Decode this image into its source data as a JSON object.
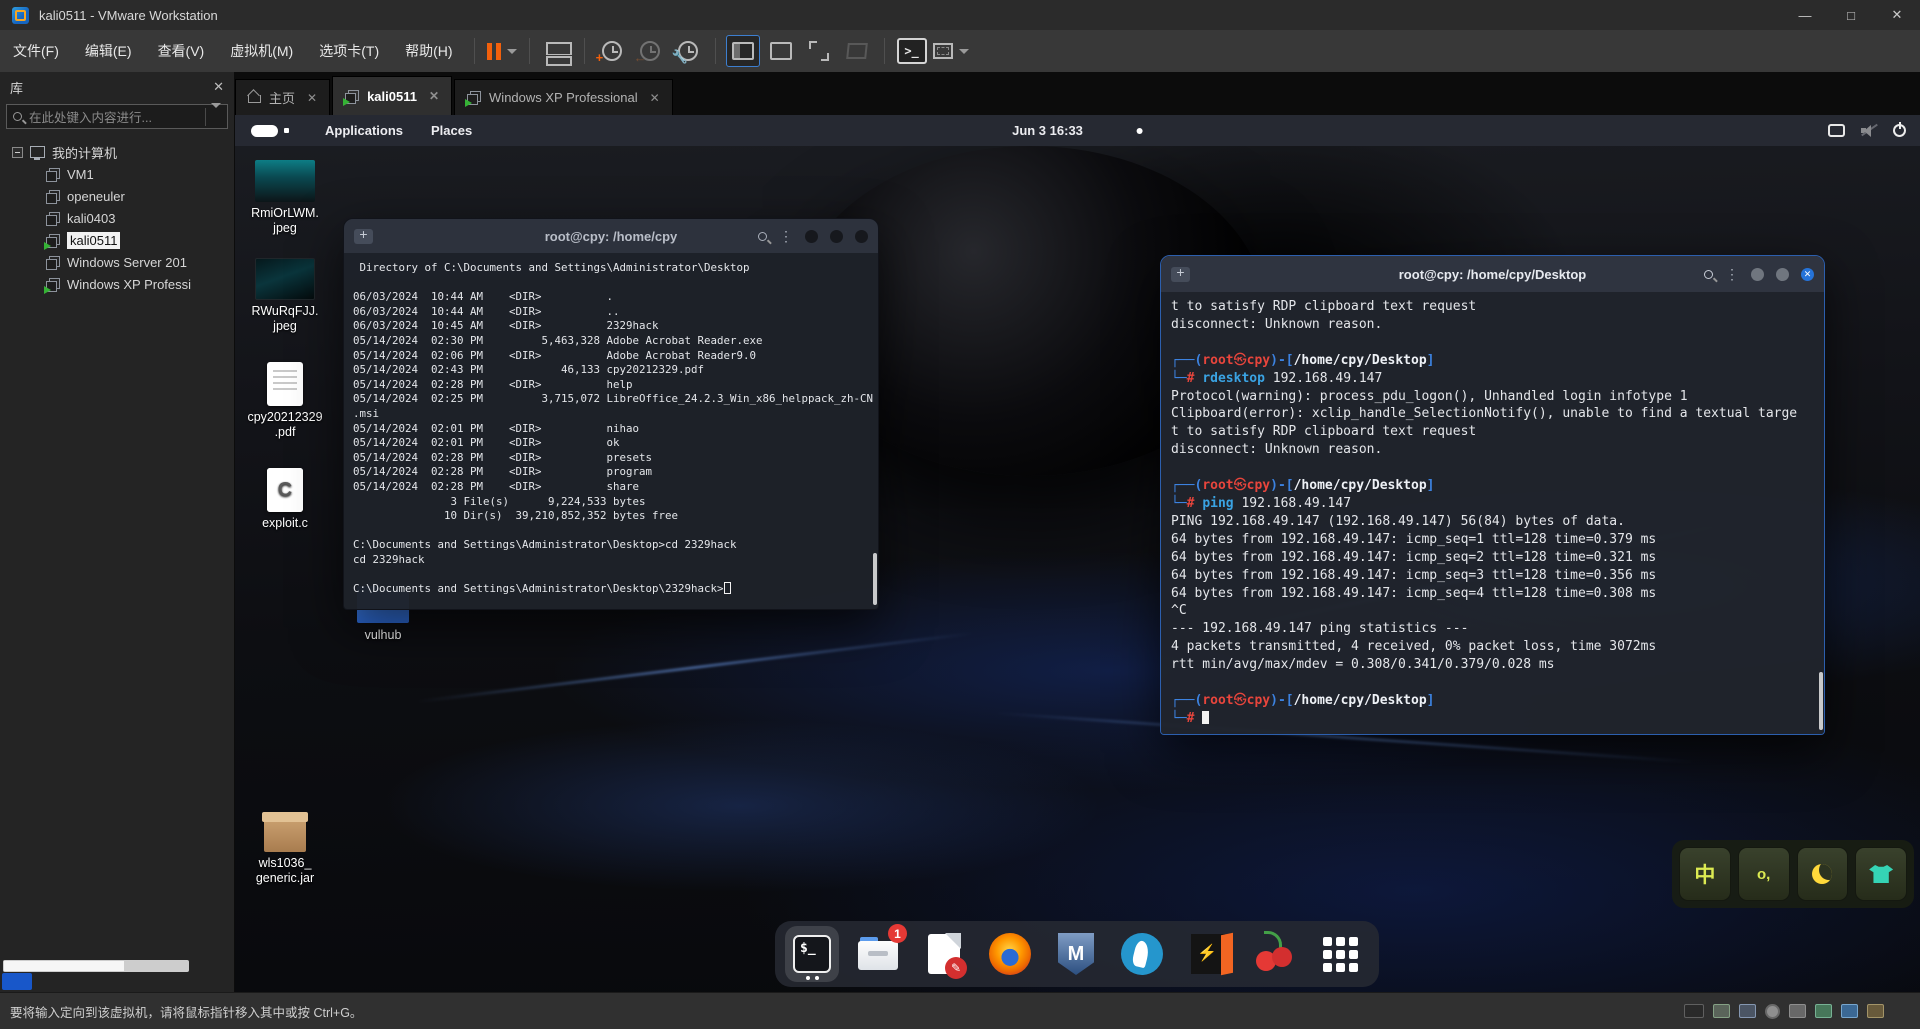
{
  "vmware": {
    "title": "kali0511 - VMware Workstation",
    "menus": [
      "文件(F)",
      "编辑(E)",
      "查看(V)",
      "虚拟机(M)",
      "选项卡(T)",
      "帮助(H)"
    ],
    "window_controls": {
      "minimize": "—",
      "maximize": "□",
      "close": "✕"
    },
    "tabs": [
      {
        "label": "主页",
        "close": "✕"
      },
      {
        "label": "kali0511",
        "close": "✕"
      },
      {
        "label": "Windows XP Professional",
        "close": "✕"
      }
    ],
    "sidebar": {
      "title": "库",
      "close": "✕",
      "search_placeholder": "在此处键入内容进行...",
      "root": "我的计算机",
      "vms": [
        {
          "name": "VM1"
        },
        {
          "name": "openeuler"
        },
        {
          "name": "kali0403"
        },
        {
          "name": "kali0511",
          "selected": true,
          "running": true
        },
        {
          "name": "Windows Server 201"
        },
        {
          "name": "Windows XP Professi",
          "running": true
        }
      ]
    },
    "statusbar": {
      "hint": "要将输入定向到该虚拟机，请将鼠标指针移入其中或按 Ctrl+G。",
      "device_icons": [
        "harddisk-icon",
        "harddisk2-icon",
        "cdrom-icon",
        "floppy-icon",
        "usb-icon",
        "network-icon",
        "sound-icon",
        "keyboard-icon"
      ]
    }
  },
  "kali": {
    "topbar": {
      "menu_applications": "Applications",
      "menu_places": "Places",
      "clock": "Jun 3 16:33",
      "tray_icons": [
        "display-icon",
        "audio-muted-icon",
        "power-icon"
      ]
    },
    "desktop_icons": [
      {
        "label1": "RmiOrLWM.",
        "label2": "jpeg",
        "type": "image"
      },
      {
        "label1": "RWuRqFJJ.",
        "label2": "jpeg",
        "type": "image"
      },
      {
        "label1": "cpy20212329",
        "label2": ".pdf",
        "type": "pdf"
      },
      {
        "label1": "exploit.c",
        "label2": "",
        "type": "code"
      },
      {
        "label1": "vulhub",
        "label2": "",
        "type": "folder"
      },
      {
        "label1": "wls1036_",
        "label2": "generic.jar",
        "type": "archive"
      }
    ],
    "dock": {
      "badge_count": "1",
      "items": [
        "terminal",
        "file-manager",
        "text-editor",
        "firefox",
        "metasploit",
        "wireshark",
        "burpsuite",
        "cherrytree",
        "app-grid"
      ]
    },
    "ime": {
      "chinese_mode": "中",
      "buttons": [
        "chinese-mode",
        "fullwidth-mode",
        "night-mode",
        "skin-picker"
      ]
    }
  },
  "term_left": {
    "title": "root@cpy: /home/cpy",
    "lines": [
      " Directory of C:\\Documents and Settings\\Administrator\\Desktop",
      "",
      "06/03/2024  10:44 AM    <DIR>          .",
      "06/03/2024  10:44 AM    <DIR>          ..",
      "06/03/2024  10:45 AM    <DIR>          2329hack",
      "05/14/2024  02:30 PM         5,463,328 Adobe Acrobat Reader.exe",
      "05/14/2024  02:06 PM    <DIR>          Adobe Acrobat Reader9.0",
      "05/14/2024  02:43 PM            46,133 cpy20212329.pdf",
      "05/14/2024  02:28 PM    <DIR>          help",
      "05/14/2024  02:25 PM         3,715,072 LibreOffice_24.2.3_Win_x86_helppack_zh-CN",
      ".msi",
      "05/14/2024  02:01 PM    <DIR>          nihao",
      "05/14/2024  02:01 PM    <DIR>          ok",
      "05/14/2024  02:28 PM    <DIR>          presets",
      "05/14/2024  02:28 PM    <DIR>          program",
      "05/14/2024  02:28 PM    <DIR>          share",
      "               3 File(s)      9,224,533 bytes",
      "              10 Dir(s)  39,210,852,352 bytes free",
      "",
      "C:\\Documents and Settings\\Administrator\\Desktop>cd 2329hack",
      "cd 2329hack",
      "",
      {
        "s": [
          [
            "C:\\Documents and Settings\\Administrator\\Desktop\\2329hack>",
            "p"
          ],
          [
            "",
            "curh"
          ]
        ]
      }
    ]
  },
  "term_right": {
    "title": "root@cpy: /home/cpy/Desktop",
    "lines": [
      "t to satisfy RDP clipboard text request",
      "disconnect: Unknown reason.",
      "",
      {
        "s": [
          [
            "┌──(",
            "b"
          ],
          [
            "root",
            "r"
          ],
          [
            "㉿",
            "rs"
          ],
          [
            "cpy",
            "r"
          ],
          [
            ")-[",
            "b"
          ],
          [
            "/home/cpy/Desktop",
            "w"
          ],
          [
            "]",
            "b"
          ]
        ]
      },
      {
        "s": [
          [
            "└─",
            "b"
          ],
          [
            "#",
            "r"
          ],
          [
            " ",
            "p"
          ],
          [
            "rdesktop",
            "c"
          ],
          [
            " 192.168.49.147",
            "p"
          ]
        ]
      },
      "Protocol(warning): process_pdu_logon(), Unhandled login infotype 1",
      "Clipboard(error): xclip_handle_SelectionNotify(), unable to find a textual targe",
      "t to satisfy RDP clipboard text request",
      "disconnect: Unknown reason.",
      "",
      {
        "s": [
          [
            "┌──(",
            "b"
          ],
          [
            "root",
            "r"
          ],
          [
            "㉿",
            "rs"
          ],
          [
            "cpy",
            "r"
          ],
          [
            ")-[",
            "b"
          ],
          [
            "/home/cpy/Desktop",
            "w"
          ],
          [
            "]",
            "b"
          ]
        ]
      },
      {
        "s": [
          [
            "└─",
            "b"
          ],
          [
            "#",
            "r"
          ],
          [
            " ",
            "p"
          ],
          [
            "ping",
            "c"
          ],
          [
            " 192.168.49.147",
            "p"
          ]
        ]
      },
      "PING 192.168.49.147 (192.168.49.147) 56(84) bytes of data.",
      "64 bytes from 192.168.49.147: icmp_seq=1 ttl=128 time=0.379 ms",
      "64 bytes from 192.168.49.147: icmp_seq=2 ttl=128 time=0.321 ms",
      "64 bytes from 192.168.49.147: icmp_seq=3 ttl=128 time=0.356 ms",
      "64 bytes from 192.168.49.147: icmp_seq=4 ttl=128 time=0.308 ms",
      "^C",
      "--- 192.168.49.147 ping statistics ---",
      "4 packets transmitted, 4 received, 0% packet loss, time 3072ms",
      "rtt min/avg/max/mdev = 0.308/0.341/0.379/0.028 ms",
      "",
      {
        "s": [
          [
            "┌──(",
            "b"
          ],
          [
            "root",
            "r"
          ],
          [
            "㉿",
            "rs"
          ],
          [
            "cpy",
            "r"
          ],
          [
            ")-[",
            "b"
          ],
          [
            "/home/cpy/Desktop",
            "w"
          ],
          [
            "]",
            "b"
          ]
        ]
      },
      {
        "s": [
          [
            "└─",
            "b"
          ],
          [
            "#",
            "r"
          ],
          [
            " ",
            "p"
          ],
          [
            "",
            "curf"
          ]
        ]
      }
    ]
  }
}
